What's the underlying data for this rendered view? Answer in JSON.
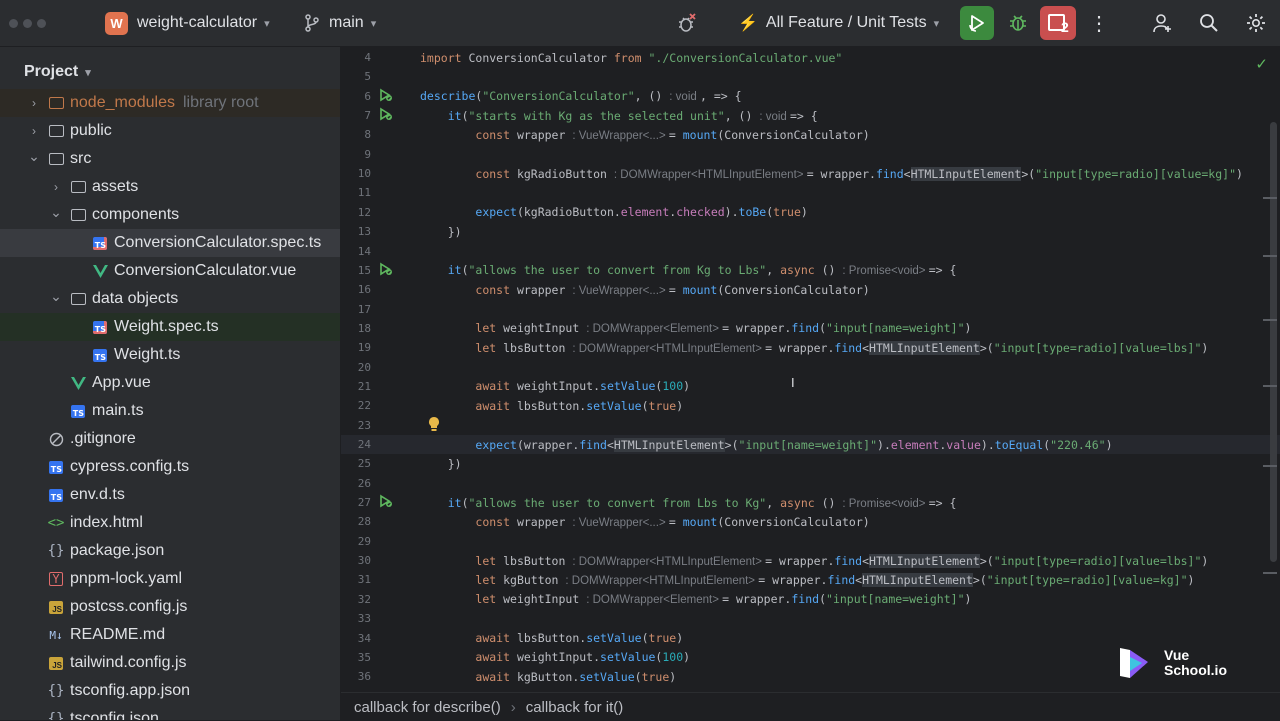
{
  "topbar": {
    "project_badge": "W",
    "project_name": "weight-calculator",
    "branch": "main",
    "run_config": "All Feature / Unit Tests",
    "problems_count": "2"
  },
  "project_panel": {
    "title": "Project",
    "items": [
      {
        "label": "node_modules",
        "suffix": "library root",
        "icon": "folder-icon",
        "indent": 1,
        "arrow": "›"
      },
      {
        "label": "public",
        "icon": "folder-icon",
        "indent": 1,
        "arrow": "›"
      },
      {
        "label": "src",
        "icon": "folder-icon",
        "indent": 1,
        "arrow": "⌄"
      },
      {
        "label": "assets",
        "icon": "folder-icon",
        "indent": 2,
        "arrow": "›"
      },
      {
        "label": "components",
        "icon": "folder-icon",
        "indent": 2,
        "arrow": "⌄"
      },
      {
        "label": "ConversionCalculator.spec.ts",
        "icon": "ts-test-icon",
        "indent": 3
      },
      {
        "label": "ConversionCalculator.vue",
        "icon": "vue-icon",
        "indent": 3
      },
      {
        "label": "data objects",
        "icon": "folder-icon",
        "indent": 2,
        "arrow": "⌄"
      },
      {
        "label": "Weight.spec.ts",
        "icon": "ts-test-icon",
        "indent": 3
      },
      {
        "label": "Weight.ts",
        "icon": "ts-icon",
        "indent": 3
      },
      {
        "label": "App.vue",
        "icon": "vue-icon",
        "indent": 2
      },
      {
        "label": "main.ts",
        "icon": "ts-icon",
        "indent": 2
      },
      {
        "label": ".gitignore",
        "icon": "ignore-icon",
        "indent": 1
      },
      {
        "label": "cypress.config.ts",
        "icon": "ts-icon",
        "indent": 1
      },
      {
        "label": "env.d.ts",
        "icon": "ts-icon",
        "indent": 1
      },
      {
        "label": "index.html",
        "icon": "html-icon",
        "indent": 1
      },
      {
        "label": "package.json",
        "icon": "json-icon",
        "indent": 1
      },
      {
        "label": "pnpm-lock.yaml",
        "icon": "yaml-icon",
        "indent": 1
      },
      {
        "label": "postcss.config.js",
        "icon": "js-icon",
        "indent": 1
      },
      {
        "label": "README.md",
        "icon": "md-icon",
        "indent": 1
      },
      {
        "label": "tailwind.config.js",
        "icon": "js-icon",
        "indent": 1
      },
      {
        "label": "tsconfig.app.json",
        "icon": "json-icon",
        "indent": 1
      },
      {
        "label": "tsconfig.json",
        "icon": "json-icon",
        "indent": 1
      }
    ]
  },
  "editor": {
    "lines": [
      {
        "n": "4",
        "tokens": [
          [
            "kw",
            "import "
          ],
          [
            "",
            "ConversionCalculator "
          ],
          [
            "kw",
            "from "
          ],
          [
            "str",
            "\"./ConversionCalculator.vue\""
          ]
        ]
      },
      {
        "n": "5",
        "tokens": []
      },
      {
        "n": "6",
        "gutter": "run",
        "tokens": [
          [
            "fn",
            "describe"
          ],
          [
            "",
            "("
          ],
          [
            "str",
            "\"ConversionCalculator\""
          ],
          [
            "",
            ", () "
          ],
          [
            "hint",
            ": void "
          ],
          [
            "",
            ", => {"
          ]
        ]
      },
      {
        "n": "7",
        "gutter": "run",
        "tokens": [
          [
            "",
            "    "
          ],
          [
            "fn",
            "it"
          ],
          [
            "",
            "("
          ],
          [
            "str",
            "\"starts with Kg as the selected unit\""
          ],
          [
            "",
            ", () "
          ],
          [
            "hint",
            ": void "
          ],
          [
            "",
            "=> {"
          ]
        ]
      },
      {
        "n": "8",
        "tokens": [
          [
            "",
            "        "
          ],
          [
            "kw",
            "const "
          ],
          [
            "",
            "wrapper "
          ],
          [
            "hint",
            ": VueWrapper<...> "
          ],
          [
            "",
            "= "
          ],
          [
            "fn",
            "mount"
          ],
          [
            "",
            "(ConversionCalculator)"
          ]
        ]
      },
      {
        "n": "9",
        "tokens": []
      },
      {
        "n": "10",
        "tokens": [
          [
            "",
            "        "
          ],
          [
            "kw",
            "const "
          ],
          [
            "",
            "kgRadioButton "
          ],
          [
            "hint",
            ": DOMWrapper<HTMLInputElement> "
          ],
          [
            "",
            "= wrapper."
          ],
          [
            "fn",
            "find"
          ],
          [
            "",
            "<"
          ],
          [
            "hl",
            "HTMLInputElement"
          ],
          [
            "",
            ">("
          ],
          [
            "str",
            "\"input[type=radio][value=kg]\""
          ],
          [
            "",
            ")"
          ]
        ]
      },
      {
        "n": "11",
        "tokens": []
      },
      {
        "n": "12",
        "tokens": [
          [
            "",
            "        "
          ],
          [
            "fn",
            "expect"
          ],
          [
            "",
            "(kgRadioButton."
          ],
          [
            "prop",
            "element"
          ],
          [
            "",
            "."
          ],
          [
            "prop",
            "checked"
          ],
          [
            "",
            ")."
          ],
          [
            "fn",
            "toBe"
          ],
          [
            "",
            "("
          ],
          [
            "kw",
            "true"
          ],
          [
            "",
            ")"
          ]
        ]
      },
      {
        "n": "13",
        "tokens": [
          [
            "",
            "    })"
          ]
        ]
      },
      {
        "n": "14",
        "tokens": []
      },
      {
        "n": "15",
        "gutter": "run",
        "tokens": [
          [
            "",
            "    "
          ],
          [
            "fn",
            "it"
          ],
          [
            "",
            "("
          ],
          [
            "str",
            "\"allows the user to convert from Kg to Lbs\""
          ],
          [
            "",
            ", "
          ],
          [
            "kw",
            "async "
          ],
          [
            "",
            "() "
          ],
          [
            "hint",
            ": Promise<void> "
          ],
          [
            "",
            "=> {"
          ]
        ]
      },
      {
        "n": "16",
        "tokens": [
          [
            "",
            "        "
          ],
          [
            "kw",
            "const "
          ],
          [
            "",
            "wrapper "
          ],
          [
            "hint",
            ": VueWrapper<...> "
          ],
          [
            "",
            "= "
          ],
          [
            "fn",
            "mount"
          ],
          [
            "",
            "(ConversionCalculator)"
          ]
        ]
      },
      {
        "n": "17",
        "tokens": []
      },
      {
        "n": "18",
        "tokens": [
          [
            "",
            "        "
          ],
          [
            "kw",
            "let "
          ],
          [
            "",
            "weightInput "
          ],
          [
            "hint",
            ": DOMWrapper<Element> "
          ],
          [
            "",
            "= wrapper."
          ],
          [
            "fn",
            "find"
          ],
          [
            "",
            "("
          ],
          [
            "str",
            "\"input[name=weight]\""
          ],
          [
            "",
            ")"
          ]
        ]
      },
      {
        "n": "19",
        "tokens": [
          [
            "",
            "        "
          ],
          [
            "kw",
            "let "
          ],
          [
            "",
            "lbsButton "
          ],
          [
            "hint",
            ": DOMWrapper<HTMLInputElement> "
          ],
          [
            "",
            "= wrapper."
          ],
          [
            "fn",
            "find"
          ],
          [
            "",
            "<"
          ],
          [
            "hl",
            "HTMLInputElement"
          ],
          [
            "",
            ">("
          ],
          [
            "str",
            "\"input[type=radio][value=lbs]\""
          ],
          [
            "",
            ")"
          ]
        ]
      },
      {
        "n": "20",
        "tokens": []
      },
      {
        "n": "21",
        "tokens": [
          [
            "",
            "        "
          ],
          [
            "kw",
            "await "
          ],
          [
            "",
            "weightInput."
          ],
          [
            "fn",
            "setValue"
          ],
          [
            "",
            "("
          ],
          [
            "num",
            "100"
          ],
          [
            "",
            ")"
          ]
        ]
      },
      {
        "n": "22",
        "tokens": [
          [
            "",
            "        "
          ],
          [
            "kw",
            "await "
          ],
          [
            "",
            "lbsButton."
          ],
          [
            "fn",
            "setValue"
          ],
          [
            "",
            "("
          ],
          [
            "kw",
            "true"
          ],
          [
            "",
            ")"
          ]
        ]
      },
      {
        "n": "23",
        "gutter": "bulb",
        "tokens": []
      },
      {
        "n": "24",
        "current": true,
        "tokens": [
          [
            "",
            "        "
          ],
          [
            "fn",
            "expect"
          ],
          [
            "",
            "(wrapper."
          ],
          [
            "fn",
            "find"
          ],
          [
            "",
            "<"
          ],
          [
            "hl",
            "HTMLInputElement"
          ],
          [
            "",
            ">("
          ],
          [
            "str",
            "\"input[name=weight]\""
          ],
          [
            "",
            ")."
          ],
          [
            "prop",
            "element"
          ],
          [
            "",
            "."
          ],
          [
            "prop",
            "value"
          ],
          [
            "",
            ")."
          ],
          [
            "fn",
            "toEqual"
          ],
          [
            "",
            "("
          ],
          [
            "str",
            "\"220.46\""
          ],
          [
            "",
            ")"
          ]
        ]
      },
      {
        "n": "25",
        "tokens": [
          [
            "",
            "    })"
          ]
        ]
      },
      {
        "n": "26",
        "tokens": []
      },
      {
        "n": "27",
        "gutter": "run",
        "tokens": [
          [
            "",
            "    "
          ],
          [
            "fn",
            "it"
          ],
          [
            "",
            "("
          ],
          [
            "str",
            "\"allows the user to convert from Lbs to Kg\""
          ],
          [
            "",
            ", "
          ],
          [
            "kw",
            "async "
          ],
          [
            "",
            "() "
          ],
          [
            "hint",
            ": Promise<void> "
          ],
          [
            "",
            "=> {"
          ]
        ]
      },
      {
        "n": "28",
        "tokens": [
          [
            "",
            "        "
          ],
          [
            "kw",
            "const "
          ],
          [
            "",
            "wrapper "
          ],
          [
            "hint",
            ": VueWrapper<...> "
          ],
          [
            "",
            "= "
          ],
          [
            "fn",
            "mount"
          ],
          [
            "",
            "(ConversionCalculator)"
          ]
        ]
      },
      {
        "n": "29",
        "tokens": []
      },
      {
        "n": "30",
        "tokens": [
          [
            "",
            "        "
          ],
          [
            "kw",
            "let "
          ],
          [
            "",
            "lbsButton "
          ],
          [
            "hint",
            ": DOMWrapper<HTMLInputElement> "
          ],
          [
            "",
            "= wrapper."
          ],
          [
            "fn",
            "find"
          ],
          [
            "",
            "<"
          ],
          [
            "hl",
            "HTMLInputElement"
          ],
          [
            "",
            ">("
          ],
          [
            "str",
            "\"input[type=radio][value=lbs]\""
          ],
          [
            "",
            ")"
          ]
        ]
      },
      {
        "n": "31",
        "tokens": [
          [
            "",
            "        "
          ],
          [
            "kw",
            "let "
          ],
          [
            "",
            "kgButton "
          ],
          [
            "hint",
            ": DOMWrapper<HTMLInputElement> "
          ],
          [
            "",
            "= wrapper."
          ],
          [
            "fn",
            "find"
          ],
          [
            "",
            "<"
          ],
          [
            "hl",
            "HTMLInputElement"
          ],
          [
            "",
            ">("
          ],
          [
            "str",
            "\"input[type=radio][value=kg]\""
          ],
          [
            "",
            ")"
          ]
        ]
      },
      {
        "n": "32",
        "tokens": [
          [
            "",
            "        "
          ],
          [
            "kw",
            "let "
          ],
          [
            "",
            "weightInput "
          ],
          [
            "hint",
            ": DOMWrapper<Element> "
          ],
          [
            "",
            "= wrapper."
          ],
          [
            "fn",
            "find"
          ],
          [
            "",
            "("
          ],
          [
            "str",
            "\"input[name=weight]\""
          ],
          [
            "",
            ")"
          ]
        ]
      },
      {
        "n": "33",
        "tokens": []
      },
      {
        "n": "34",
        "tokens": [
          [
            "",
            "        "
          ],
          [
            "kw",
            "await "
          ],
          [
            "",
            "lbsButton."
          ],
          [
            "fn",
            "setValue"
          ],
          [
            "",
            "("
          ],
          [
            "kw",
            "true"
          ],
          [
            "",
            ")"
          ]
        ]
      },
      {
        "n": "35",
        "tokens": [
          [
            "",
            "        "
          ],
          [
            "kw",
            "await "
          ],
          [
            "",
            "weightInput."
          ],
          [
            "fn",
            "setValue"
          ],
          [
            "",
            "("
          ],
          [
            "num",
            "100"
          ],
          [
            "",
            ")"
          ]
        ]
      },
      {
        "n": "36",
        "tokens": [
          [
            "",
            "        "
          ],
          [
            "kw",
            "await "
          ],
          [
            "",
            "kgButton."
          ],
          [
            "fn",
            "setValue"
          ],
          [
            "",
            "("
          ],
          [
            "kw",
            "true"
          ],
          [
            "",
            ")"
          ]
        ]
      }
    ]
  },
  "breadcrumb": {
    "items": [
      "callback for describe()",
      "callback for it()"
    ]
  },
  "watermark": {
    "line1": "Vue",
    "line2": "School.io"
  }
}
